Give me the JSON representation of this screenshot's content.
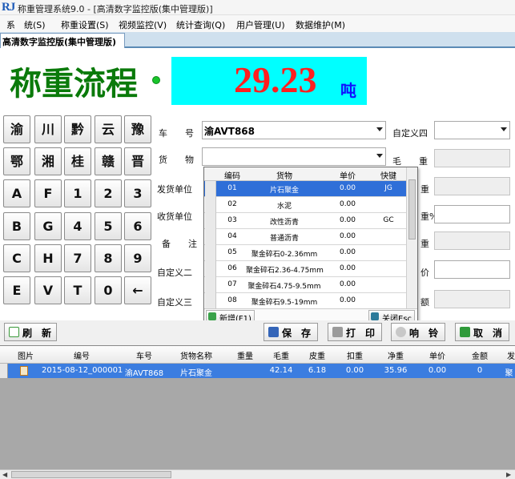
{
  "window": {
    "title": "称重管理系统9.0 - [高清数字监控版(集中管理版)]",
    "logo_text": "RJ"
  },
  "menu": [
    "系　统(S)",
    "称重设置(S)",
    "视频监控(V)",
    "统计查询(Q)",
    "用户管理(U)",
    "数据维护(M)"
  ],
  "tab": {
    "label": "高清数字监控版(集中管理版)"
  },
  "header": {
    "title": "称重流程",
    "weight_value": "29.23",
    "weight_unit": "吨"
  },
  "keypad": [
    "渝",
    "川",
    "黔",
    "云",
    "豫",
    "鄂",
    "湘",
    "桂",
    "赣",
    "晋",
    "A",
    "F",
    "1",
    "2",
    "3",
    "B",
    "G",
    "4",
    "5",
    "6",
    "C",
    "H",
    "7",
    "8",
    "9",
    "E",
    "V",
    "T",
    "0",
    "←"
  ],
  "form": {
    "plate_label": "车　　号",
    "plate_value": "渝AVT868",
    "goods_label": "货　　物",
    "sender_label": "发货单位",
    "receiver_label": "收货单位",
    "remark_label": "备　　注",
    "custom2_label": "自定义二",
    "custom3_label": "自定义三",
    "custom4_label": "自定义四",
    "gross_label": "毛　　重",
    "tare_label": "重",
    "deduct_label": "重%",
    "net_label": "重",
    "price_label": "价",
    "amount_label": "额"
  },
  "dropdown": {
    "columns": [
      "编码",
      "货物",
      "单价",
      "快键"
    ],
    "rows": [
      {
        "code": "01",
        "name": "片石聚金",
        "price": "0.00",
        "key": "JG"
      },
      {
        "code": "02",
        "name": "水泥",
        "price": "0.00",
        "key": ""
      },
      {
        "code": "03",
        "name": "改性沥青",
        "price": "0.00",
        "key": "GC"
      },
      {
        "code": "04",
        "name": "普通沥青",
        "price": "0.00",
        "key": ""
      },
      {
        "code": "05",
        "name": "聚金碎石0-2.36mm",
        "price": "0.00",
        "key": ""
      },
      {
        "code": "06",
        "name": "聚金碎石2.36-4.75mm",
        "price": "0.00",
        "key": ""
      },
      {
        "code": "07",
        "name": "聚金碎石4.75-9.5mm",
        "price": "0.00",
        "key": ""
      },
      {
        "code": "08",
        "name": "聚金碎石9.5-19mm",
        "price": "0.00",
        "key": ""
      }
    ],
    "selected_index": 0,
    "add_label": "新增(F1)",
    "close_label": "关闭Esc"
  },
  "toolbar": {
    "refresh": "刷　新",
    "save": "保　存",
    "print": "打　印",
    "bell": "响　铃",
    "cancel": "取　消"
  },
  "grid": {
    "columns": [
      "图片",
      "编号",
      "车号",
      "货物名称",
      "毛重",
      "皮重",
      "扣重",
      "净重",
      "单价",
      "金额",
      "发"
    ],
    "rows": [
      {
        "id": "2015-08-12_000001",
        "plate": "渝AVT868",
        "goods": "片石聚金",
        "gross": "42.14",
        "tare": "6.18",
        "deduct": "0.00",
        "net": "35.96",
        "price": "0.00",
        "amount": "0",
        "sender": "聚"
      }
    ],
    "extra_column": "重量"
  },
  "colors": {
    "title_green": "#0a7a0a",
    "weight_bg": "#00ffff",
    "weight_red": "#ff1f1f",
    "unit_blue": "#1010ff",
    "selection_blue": "#2f6fd8"
  }
}
